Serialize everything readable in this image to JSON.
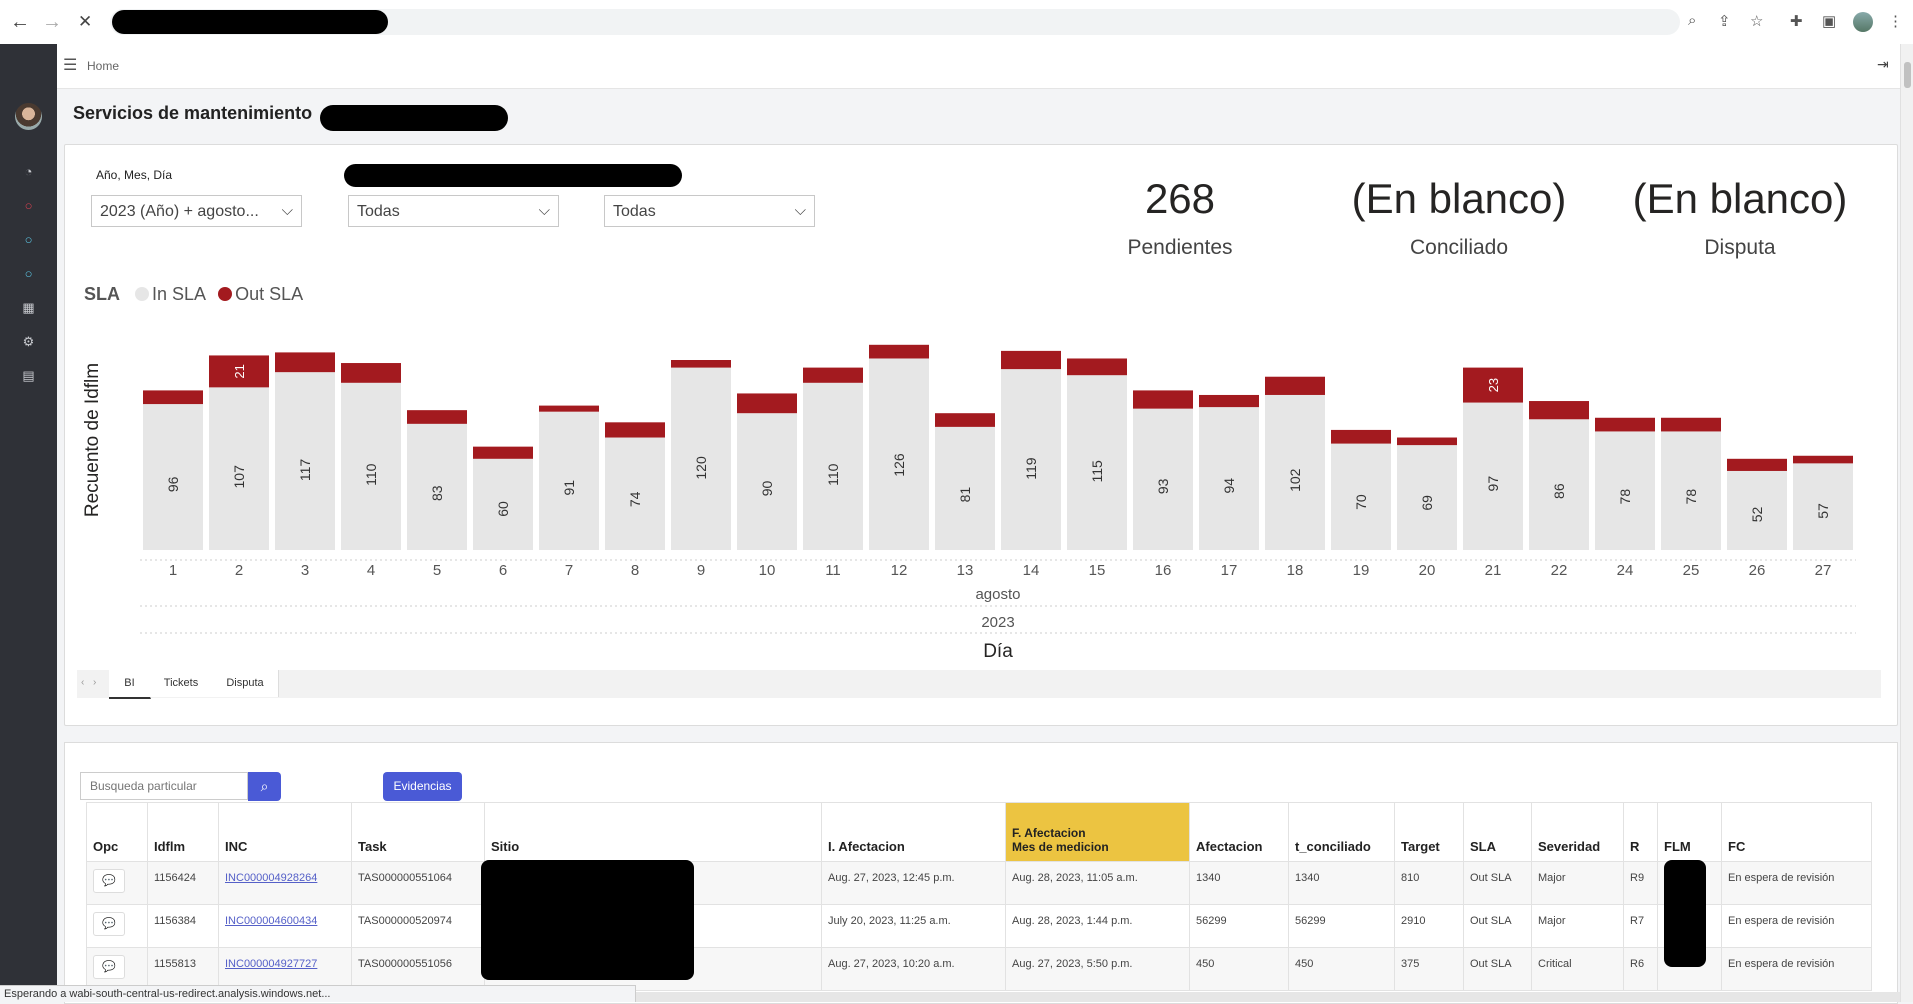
{
  "browser": {
    "back_icon": "←",
    "forward_icon": "→",
    "close_icon": "✕"
  },
  "topbar": {
    "home": "Home"
  },
  "page": {
    "title": "Servicios de mantenimiento"
  },
  "filters": {
    "date_label": "Año, Mes, Día",
    "date_value": "2023 (Año) + agosto...",
    "filter2_value": "Todas",
    "filter3_value": "Todas"
  },
  "kpis": [
    {
      "value": "268",
      "label": "Pendientes"
    },
    {
      "value": "(En blanco)",
      "label": "Conciliado"
    },
    {
      "value": "(En blanco)",
      "label": "Disputa"
    }
  ],
  "chart_data": {
    "type": "bar",
    "stacked": true,
    "legend_title": "SLA",
    "ylabel": "Recuento de Idflm",
    "xlabel": "Día",
    "x_hierarchy": [
      "agosto",
      "2023"
    ],
    "categories": [
      "1",
      "2",
      "3",
      "4",
      "5",
      "6",
      "7",
      "8",
      "9",
      "10",
      "11",
      "12",
      "13",
      "14",
      "15",
      "16",
      "17",
      "18",
      "19",
      "20",
      "21",
      "22",
      "24",
      "25",
      "26",
      "27"
    ],
    "series": [
      {
        "name": "In SLA",
        "color": "#e6e6e6",
        "values": [
          96,
          107,
          117,
          110,
          83,
          60,
          91,
          74,
          120,
          90,
          110,
          126,
          81,
          119,
          115,
          93,
          94,
          102,
          70,
          69,
          97,
          86,
          78,
          78,
          52,
          57
        ]
      },
      {
        "name": "Out SLA",
        "color": "#a31a1f",
        "values": [
          9,
          21,
          13,
          13,
          9,
          8,
          4,
          10,
          5,
          13,
          10,
          9,
          9,
          12,
          11,
          12,
          8,
          12,
          9,
          5,
          23,
          12,
          9,
          9,
          8,
          5
        ]
      }
    ],
    "ylim": [
      0,
      160
    ],
    "grid": false
  },
  "tabs": [
    "BI",
    "Tickets",
    "Disputa"
  ],
  "table": {
    "search_placeholder": "Busqueda particular",
    "evidencias": "Evidencias",
    "columns": [
      "Opc",
      "Idflm",
      "INC",
      "Task",
      "Sitio",
      "I. Afectacion",
      "F. Afectacion",
      "Mes de medicion",
      "Afectacion",
      "t_conciliado",
      "Target",
      "SLA",
      "Severidad",
      "R",
      "FLM",
      "FC"
    ],
    "rows": [
      {
        "idflm": "1156424",
        "inc": "INC000004928264",
        "task": "TAS000000551064",
        "i_afect": "Aug. 27, 2023, 12:45 p.m.",
        "f_afect": "Aug. 28, 2023, 11:05 a.m.",
        "afect": "1340",
        "tconc": "1340",
        "target": "810",
        "sla": "Out SLA",
        "sev": "Major",
        "r": "R9",
        "fc": "En espera de revisión"
      },
      {
        "idflm": "1156384",
        "inc": "INC000004600434",
        "task": "TAS000000520974",
        "i_afect": "July 20, 2023, 11:25 a.m.",
        "f_afect": "Aug. 28, 2023, 1:44 p.m.",
        "afect": "56299",
        "tconc": "56299",
        "target": "2910",
        "sla": "Out SLA",
        "sev": "Major",
        "r": "R7",
        "fc": "En espera de revisión"
      },
      {
        "idflm": "1155813",
        "inc": "INC000004927727",
        "task": "TAS000000551056",
        "i_afect": "Aug. 27, 2023, 10:20 a.m.",
        "f_afect": "Aug. 27, 2023, 5:50 p.m.",
        "afect": "450",
        "tconc": "450",
        "target": "375",
        "sla": "Out SLA",
        "sev": "Critical",
        "r": "R6",
        "fc": "En espera de revisión"
      }
    ]
  },
  "status_bar": "Esperando a wabi-south-central-us-redirect.analysis.windows.net..."
}
